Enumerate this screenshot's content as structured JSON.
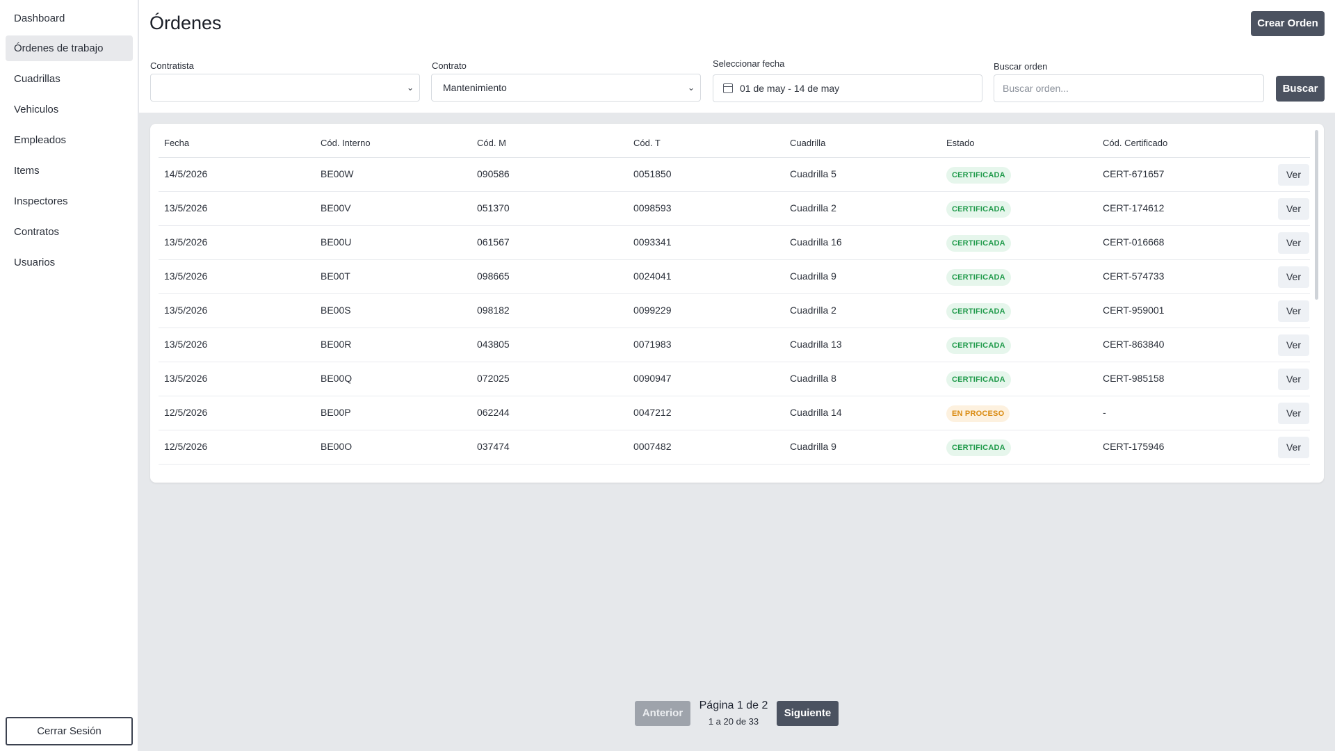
{
  "sidebar": {
    "items": [
      {
        "label": "Dashboard"
      },
      {
        "label": "Órdenes de trabajo"
      },
      {
        "label": "Cuadrillas"
      },
      {
        "label": "Vehiculos"
      },
      {
        "label": "Empleados"
      },
      {
        "label": "Items"
      },
      {
        "label": "Inspectores"
      },
      {
        "label": "Contratos"
      },
      {
        "label": "Usuarios"
      }
    ],
    "active_index": 1,
    "logout_label": "Cerrar Sesión"
  },
  "header": {
    "title": "Órdenes",
    "create_label": "Crear Orden"
  },
  "filters": {
    "contratista": {
      "label": "Contratista",
      "value": ""
    },
    "contrato": {
      "label": "Contrato",
      "value": "Mantenimiento"
    },
    "fecha": {
      "label": "Seleccionar fecha",
      "value": "01 de may - 14 de may"
    },
    "buscar": {
      "label": "Buscar orden",
      "placeholder": "Buscar orden...",
      "button_label": "Buscar"
    }
  },
  "table": {
    "columns": [
      "Fecha",
      "Cód. Interno",
      "Cód. M",
      "Cód. T",
      "Cuadrilla",
      "Estado",
      "Cód. Certificado"
    ],
    "action_label": "Ver",
    "rows": [
      {
        "fecha": "14/5/2026",
        "interno": "BE00W",
        "m": "090586",
        "t": "0051850",
        "cuadrilla": "Cuadrilla 5",
        "estado": "CERTIFICADA",
        "cert": "CERT-671657"
      },
      {
        "fecha": "13/5/2026",
        "interno": "BE00V",
        "m": "051370",
        "t": "0098593",
        "cuadrilla": "Cuadrilla 2",
        "estado": "CERTIFICADA",
        "cert": "CERT-174612"
      },
      {
        "fecha": "13/5/2026",
        "interno": "BE00U",
        "m": "061567",
        "t": "0093341",
        "cuadrilla": "Cuadrilla 16",
        "estado": "CERTIFICADA",
        "cert": "CERT-016668"
      },
      {
        "fecha": "13/5/2026",
        "interno": "BE00T",
        "m": "098665",
        "t": "0024041",
        "cuadrilla": "Cuadrilla 9",
        "estado": "CERTIFICADA",
        "cert": "CERT-574733"
      },
      {
        "fecha": "13/5/2026",
        "interno": "BE00S",
        "m": "098182",
        "t": "0099229",
        "cuadrilla": "Cuadrilla 2",
        "estado": "CERTIFICADA",
        "cert": "CERT-959001"
      },
      {
        "fecha": "13/5/2026",
        "interno": "BE00R",
        "m": "043805",
        "t": "0071983",
        "cuadrilla": "Cuadrilla 13",
        "estado": "CERTIFICADA",
        "cert": "CERT-863840"
      },
      {
        "fecha": "13/5/2026",
        "interno": "BE00Q",
        "m": "072025",
        "t": "0090947",
        "cuadrilla": "Cuadrilla 8",
        "estado": "CERTIFICADA",
        "cert": "CERT-985158"
      },
      {
        "fecha": "12/5/2026",
        "interno": "BE00P",
        "m": "062244",
        "t": "0047212",
        "cuadrilla": "Cuadrilla 14",
        "estado": "EN PROCESO",
        "cert": "-"
      },
      {
        "fecha": "12/5/2026",
        "interno": "BE00O",
        "m": "037474",
        "t": "0007482",
        "cuadrilla": "Cuadrilla 9",
        "estado": "CERTIFICADA",
        "cert": "CERT-175946"
      }
    ]
  },
  "pagination": {
    "prev_label": "Anterior",
    "next_label": "Siguiente",
    "page_text": "Página 1 de 2",
    "range_text": "1 a 20 de 33"
  },
  "colors": {
    "primary_button": "#4b5260",
    "status_certificada": "#1f9a4a",
    "status_en_proceso": "#d98a10"
  }
}
